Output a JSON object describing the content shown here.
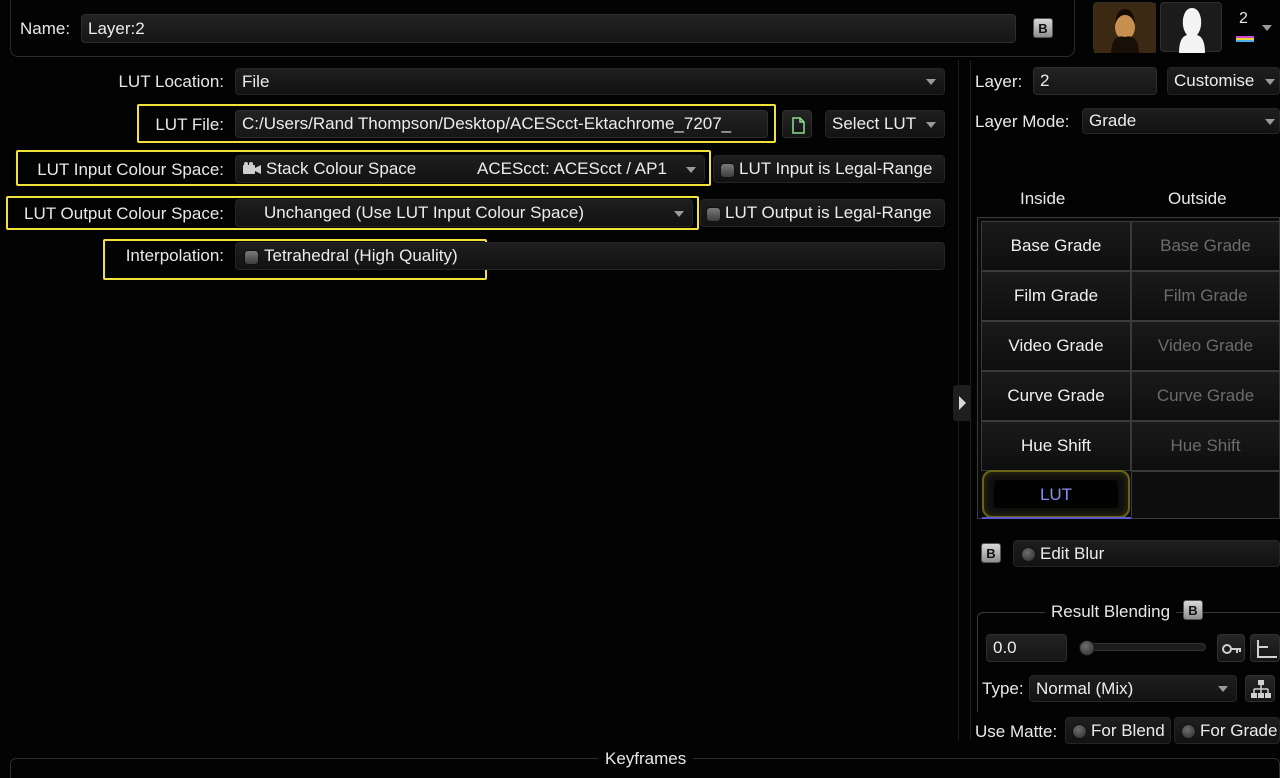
{
  "header": {
    "name_label": "Name:",
    "name_value": "Layer:2",
    "b_label": "B",
    "layer_count": "2"
  },
  "lut": {
    "location_label": "LUT Location:",
    "location_value": "File",
    "file_label": "LUT File:",
    "file_value": "C:/Users/Rand Thompson/Desktop/ACEScct-Ektachrome_7207_",
    "select_lut_label": "Select LUT",
    "input_cs_label": "LUT Input Colour Space:",
    "input_cs_value": "Stack Colour Space",
    "input_cs_detail": "ACEScct: ACEScct / AP1",
    "input_legal_label": "LUT Input is Legal-Range",
    "output_cs_label": "LUT Output Colour Space:",
    "output_cs_value": "Unchanged (Use LUT Input Colour Space)",
    "output_legal_label": "LUT Output is Legal-Range",
    "interp_label": "Interpolation:",
    "interp_value": "Tetrahedral (High Quality)"
  },
  "right_panel": {
    "layer_label": "Layer:",
    "layer_value": "2",
    "customise_label": "Customise",
    "layer_mode_label": "Layer Mode:",
    "layer_mode_value": "Grade",
    "inside_label": "Inside",
    "outside_label": "Outside",
    "grades_inside": [
      "Base Grade",
      "Film Grade",
      "Video Grade",
      "Curve Grade",
      "Hue Shift",
      "LUT"
    ],
    "grades_outside": [
      "Base Grade",
      "Film Grade",
      "Video Grade",
      "Curve Grade",
      "Hue Shift"
    ],
    "b_label": "B",
    "edit_blur_label": "Edit Blur",
    "result_blending_label": "Result Blending",
    "blend_value": "0.0",
    "type_label": "Type:",
    "type_value": "Normal (Mix)",
    "use_matte_label": "Use Matte:",
    "for_blend_label": "For Blend",
    "for_grade_label": "For Grade"
  },
  "footer": {
    "keyframes_label": "Keyframes"
  },
  "colors": {
    "highlight": "#f1e13c",
    "lut_text": "#8c8cf0",
    "background": "#030303"
  }
}
